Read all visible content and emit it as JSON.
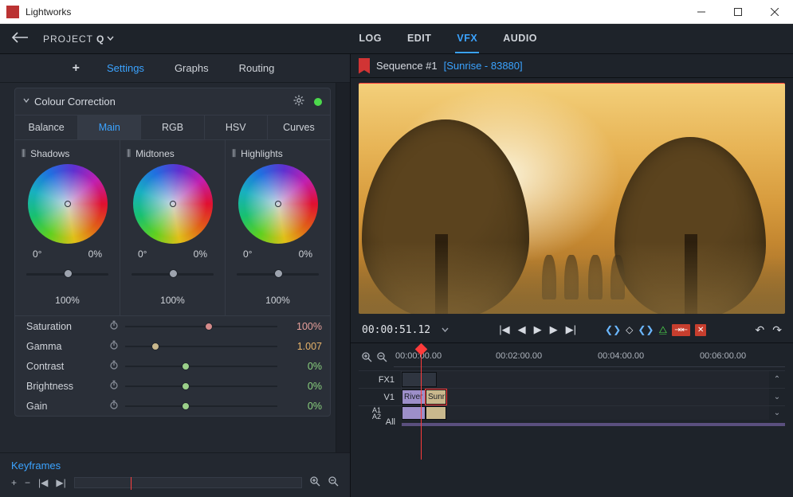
{
  "window": {
    "app_name": "Lightworks"
  },
  "topnav": {
    "project_label": "PROJECT",
    "project_name": "Q",
    "tabs": {
      "log": "LOG",
      "edit": "EDIT",
      "vfx": "VFX",
      "audio": "AUDIO"
    }
  },
  "left_header": {
    "settings": "Settings",
    "graphs": "Graphs",
    "routing": "Routing"
  },
  "panel": {
    "title": "Colour Correction",
    "cc_tabs": {
      "balance": "Balance",
      "main": "Main",
      "rgb": "RGB",
      "hsv": "HSV",
      "curves": "Curves"
    },
    "wheels": {
      "shadows": {
        "label": "Shadows",
        "angle": "0°",
        "pct": "0%",
        "master": "100%"
      },
      "midtones": {
        "label": "Midtones",
        "angle": "0°",
        "pct": "0%",
        "master": "100%"
      },
      "highlights": {
        "label": "Highlights",
        "angle": "0°",
        "pct": "0%",
        "master": "100%"
      }
    },
    "params": {
      "saturation": {
        "label": "Saturation",
        "value": "100%",
        "pos": 55,
        "thumb": "#d48a8a",
        "color": "#e7a09b"
      },
      "gamma": {
        "label": "Gamma",
        "value": "1.007",
        "pos": 20,
        "thumb": "#c9b88d",
        "color": "#e7b36a"
      },
      "contrast": {
        "label": "Contrast",
        "value": "0%",
        "pos": 40,
        "thumb": "#9bd08a",
        "color": "#8bd27f"
      },
      "brightness": {
        "label": "Brightness",
        "value": "0%",
        "pos": 40,
        "thumb": "#9bd08a",
        "color": "#8bd27f"
      },
      "gain": {
        "label": "Gain",
        "value": "0%",
        "pos": 40,
        "thumb": "#9bd08a",
        "color": "#8bd27f"
      }
    }
  },
  "keyframes": {
    "title": "Keyframes"
  },
  "sequence": {
    "name": "Sequence #1",
    "clip": "[Sunrise - 83880]"
  },
  "transport": {
    "timecode": "00:00:51.12"
  },
  "timeline": {
    "ticks": [
      "00:00:00.00",
      "00:02:00.00",
      "00:04:00.00",
      "00:06:00.00"
    ],
    "tracks": {
      "fx1": "FX1",
      "v1": "V1",
      "a1": "A1",
      "a2": "A2",
      "all": "All"
    },
    "clips": {
      "river": "River",
      "sunr": "Sunr"
    }
  }
}
